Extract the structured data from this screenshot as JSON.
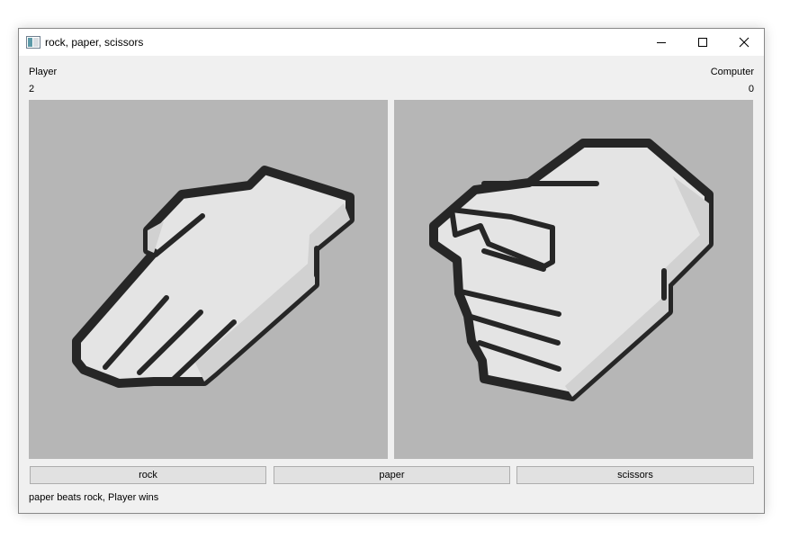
{
  "window": {
    "title": "rock, paper, scissors",
    "icon": "app-window-icon",
    "controls": [
      "minimize-icon",
      "maximize-icon",
      "close-icon"
    ]
  },
  "player": {
    "label": "Player",
    "score": "2",
    "choice": "paper"
  },
  "computer": {
    "label": "Computer",
    "score": "0",
    "choice": "rock"
  },
  "buttons": {
    "rock": "rock",
    "paper": "paper",
    "scissors": "scissors"
  },
  "status": "paper beats rock, Player wins",
  "colors": {
    "panel": "#b6b6b6",
    "hand_fill": "#e4e4e4",
    "hand_shadow": "#d1d1d1",
    "hand_outline": "#262626"
  }
}
